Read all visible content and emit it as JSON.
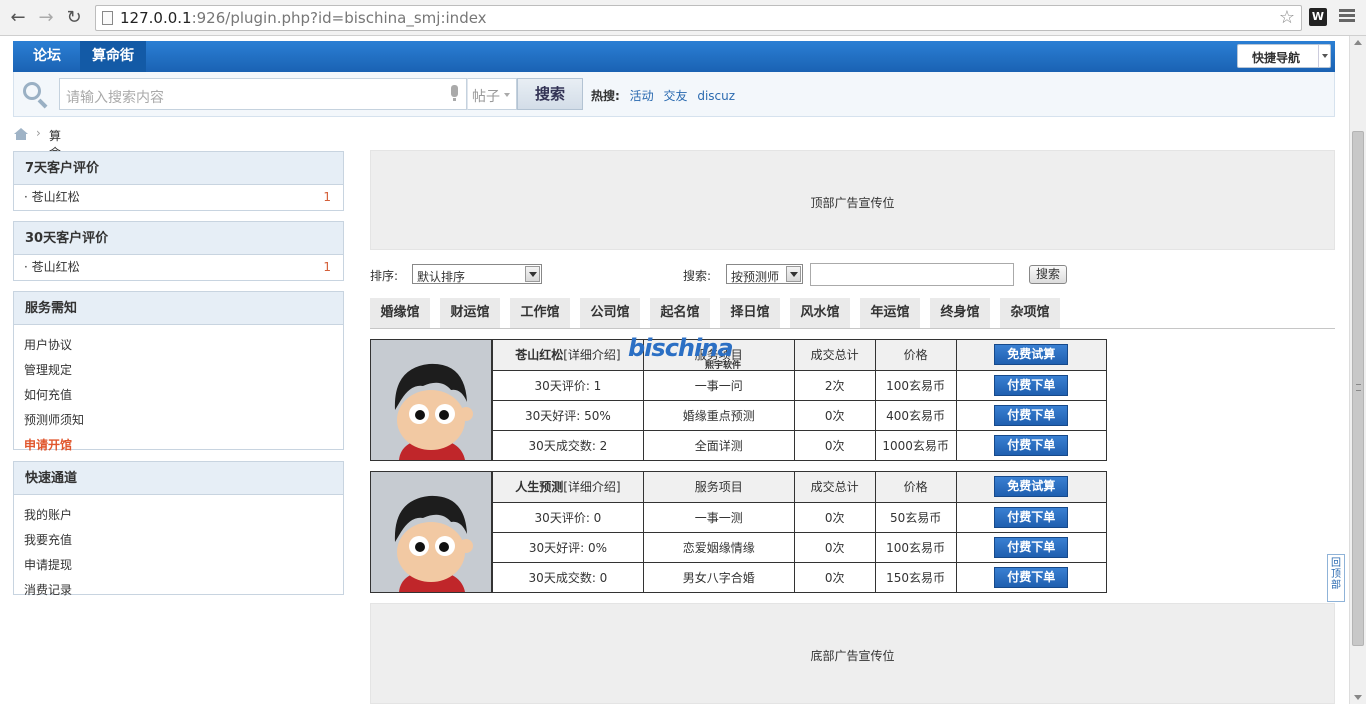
{
  "browser": {
    "url_host": "127.0.0.1",
    "url_rest": ":926/plugin.php?id=bischina_smj:index",
    "ext_label": "W"
  },
  "nav": {
    "tabs": [
      {
        "label": "论坛"
      },
      {
        "label": "算命街"
      }
    ],
    "quick_nav": "快捷导航"
  },
  "search": {
    "placeholder": "请输入搜索内容",
    "type": "帖子",
    "button": "搜索",
    "hot_label": "热搜:",
    "hot": [
      "活动",
      "交友",
      "discuz"
    ]
  },
  "breadcrumb": {
    "current": "算命街"
  },
  "sidebar": {
    "week": {
      "title": "7天客户评价",
      "items": [
        {
          "name": "苍山红松",
          "count": "1"
        }
      ]
    },
    "month": {
      "title": "30天客户评价",
      "items": [
        {
          "name": "苍山红松",
          "count": "1"
        }
      ]
    },
    "service": {
      "title": "服务需知",
      "items": [
        "用户协议",
        "管理规定",
        "如何充值",
        "预测师须知",
        "申请开馆"
      ]
    },
    "quick": {
      "title": "快速通道",
      "items": [
        "我的账户",
        "我要充值",
        "申请提现",
        "消费记录"
      ]
    }
  },
  "ads": {
    "top": "顶部广告宣传位",
    "bottom": "底部广告宣传位"
  },
  "filter": {
    "sort_label": "排序:",
    "sort_value": "默认排序",
    "search_label": "搜索:",
    "search_type": "按预测师",
    "search_value": "",
    "search_button": "搜索"
  },
  "categories": [
    "婚缘馆",
    "财运馆",
    "工作馆",
    "公司馆",
    "起名馆",
    "择日馆",
    "风水馆",
    "年运馆",
    "终身馆",
    "杂项馆"
  ],
  "watermark": {
    "text": "bischina",
    "sub": "熙宇软件"
  },
  "shops": [
    {
      "name": "苍山红松",
      "detail": "[详细介绍]",
      "headers": [
        "服务项目",
        "成交总计",
        "价格"
      ],
      "trial": "免费试算",
      "stats": [
        "30天评价: 1",
        "30天好评: 50%",
        "30天成交数: 2"
      ],
      "services": [
        {
          "item": "一事一问",
          "total": "2次",
          "price": "100玄易币",
          "order": "付费下单"
        },
        {
          "item": "婚缘重点预测",
          "total": "0次",
          "price": "400玄易币",
          "order": "付费下单"
        },
        {
          "item": "全面详测",
          "total": "0次",
          "price": "1000玄易币",
          "order": "付费下单"
        }
      ]
    },
    {
      "name": "人生预测",
      "detail": "[详细介绍]",
      "headers": [
        "服务项目",
        "成交总计",
        "价格"
      ],
      "trial": "免费试算",
      "stats": [
        "30天评价: 0",
        "30天好评: 0%",
        "30天成交数: 0"
      ],
      "services": [
        {
          "item": "一事一测",
          "total": "0次",
          "price": "50玄易币",
          "order": "付费下单"
        },
        {
          "item": "恋爱姻缘情缘",
          "total": "0次",
          "price": "100玄易币",
          "order": "付费下单"
        },
        {
          "item": "男女八字合婚",
          "total": "0次",
          "price": "150玄易币",
          "order": "付费下单"
        }
      ]
    }
  ],
  "to_top": "回顶部"
}
